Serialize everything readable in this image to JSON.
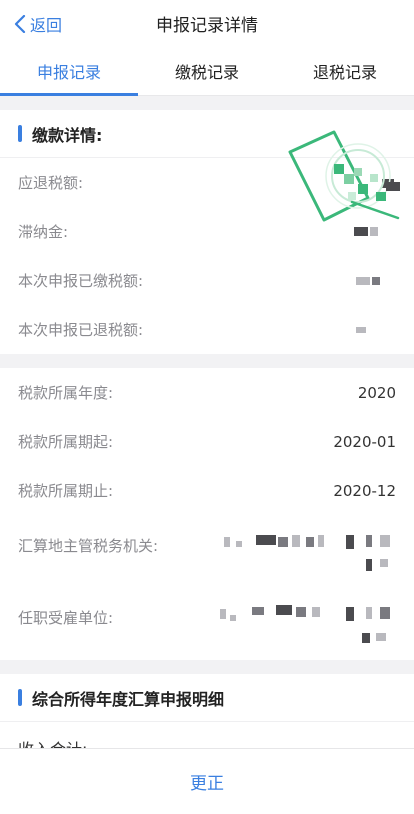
{
  "header": {
    "back_label": "返回",
    "title": "申报记录详情"
  },
  "tabs": [
    {
      "label": "申报记录",
      "active": true
    },
    {
      "label": "缴税记录",
      "active": false
    },
    {
      "label": "退税记录",
      "active": false
    }
  ],
  "payment_section": {
    "title": "缴款详情:",
    "rows": [
      {
        "label": "应退税额:"
      },
      {
        "label": "滞纳金:"
      },
      {
        "label": "本次申报已缴税额:"
      },
      {
        "label": "本次申报已退税额:"
      }
    ]
  },
  "tax_info": {
    "year_label": "税款所属年度:",
    "year_value": "2020",
    "start_label": "税款所属期起:",
    "start_value": "2020-01",
    "end_label": "税款所属期止:",
    "end_value": "2020-12",
    "authority_label": "汇算地主管税务机关:",
    "employer_label": "任职受雇单位:"
  },
  "detail_section": {
    "title": "综合所得年度汇算申报明细",
    "income_label": "收入合计:"
  },
  "footer": {
    "correct_label": "更正"
  },
  "colors": {
    "accent": "#3a7fe0",
    "stamp": "#3bb87a"
  }
}
